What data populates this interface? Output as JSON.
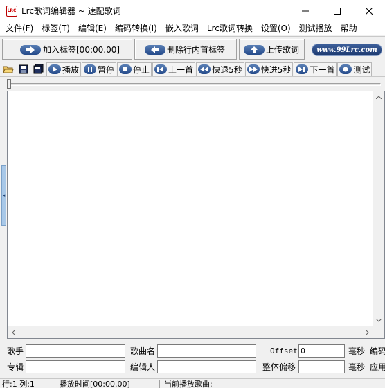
{
  "window": {
    "title": "Lrc歌词编辑器 ~ 速配歌词",
    "app_icon_text": "LRC"
  },
  "menu": [
    "文件(F)",
    "标签(T)",
    "编辑(E)",
    "编码转换(I)",
    "嵌入歌词",
    "Lrc歌词转换",
    "设置(O)",
    "测试播放",
    "帮助"
  ],
  "big_toolbar": {
    "add_tag": "加入标签[00:00.00]",
    "delete_first_tag": "删除行内首标签",
    "upload_lyrics": "上传歌词",
    "brand": "www.99Lrc.com"
  },
  "small_toolbar": {
    "play": "播放",
    "pause": "暂停",
    "stop": "停止",
    "prev": "上一首",
    "rewind": "快退5秒",
    "forward": "快进5秒",
    "next": "下一首",
    "test": "测试"
  },
  "fields": {
    "singer_label": "歌手",
    "singer_value": "",
    "song_label": "歌曲名",
    "song_value": "",
    "offset_label": "Offset",
    "offset_value": "0",
    "ms1_label": "毫秒",
    "encode_label": "编码",
    "album_label": "专辑",
    "album_value": "",
    "editor_label": "编辑人",
    "editor_value": "",
    "shift_label": "整体偏移",
    "shift_value": "",
    "ms2_label": "毫秒",
    "apply_label": "应用"
  },
  "status": {
    "position": "行:1 列:1",
    "play_time": "播放时间[00:00.00]",
    "current_song": "当前播放歌曲:"
  },
  "icons": [
    "open-folder-icon",
    "save-icon",
    "save-as-icon"
  ],
  "colors": {
    "button_accent": "#244a8a",
    "brand_bg": "#1d3a70"
  }
}
